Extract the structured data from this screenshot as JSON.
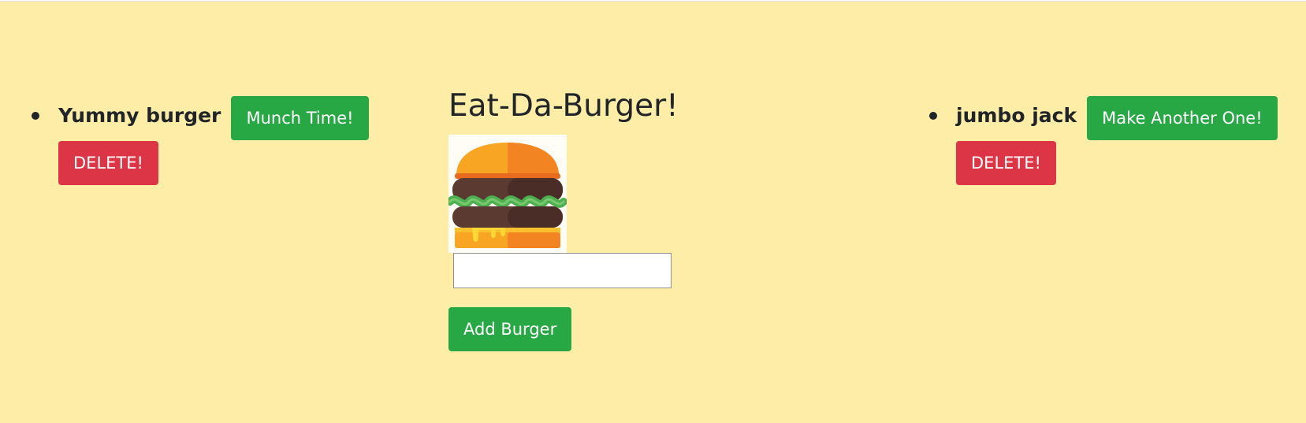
{
  "app": {
    "title": "Eat-Da-Burger!"
  },
  "uneaten": {
    "items": [
      {
        "name": "Yummy burger",
        "action_label": "Munch Time!",
        "delete_label": "DELETE!"
      }
    ]
  },
  "eaten": {
    "items": [
      {
        "name": "jumbo jack",
        "action_label": "Make Another One!",
        "delete_label": "DELETE!"
      }
    ]
  },
  "form": {
    "input_value": "",
    "placeholder": "",
    "submit_label": "Add Burger"
  },
  "icons": {
    "logo": "burger-icon"
  },
  "colors": {
    "background": "#fdeda6",
    "success": "#28a745",
    "danger": "#dc3545",
    "text": "#212529"
  }
}
